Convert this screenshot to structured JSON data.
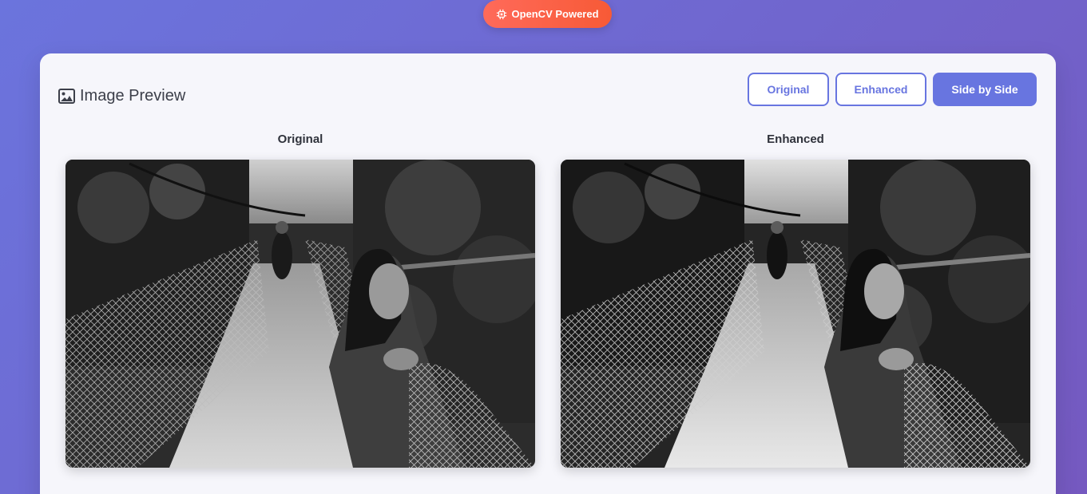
{
  "badge": {
    "icon": "chip-icon",
    "label": "OpenCV Powered",
    "colors": [
      "#ff6a5a",
      "#f75a36"
    ]
  },
  "preview": {
    "icon": "image-icon",
    "title": "Image Preview"
  },
  "view_modes": {
    "original": "Original",
    "enhanced": "Enhanced",
    "side_by_side": "Side by Side",
    "active": "side_by_side"
  },
  "panels": {
    "left_label": "Original",
    "right_label": "Enhanced"
  },
  "colors": {
    "accent": "#6875e0",
    "background_start": "#6b74dd",
    "background_end": "#7559c0",
    "card": "#f6f6fb"
  }
}
